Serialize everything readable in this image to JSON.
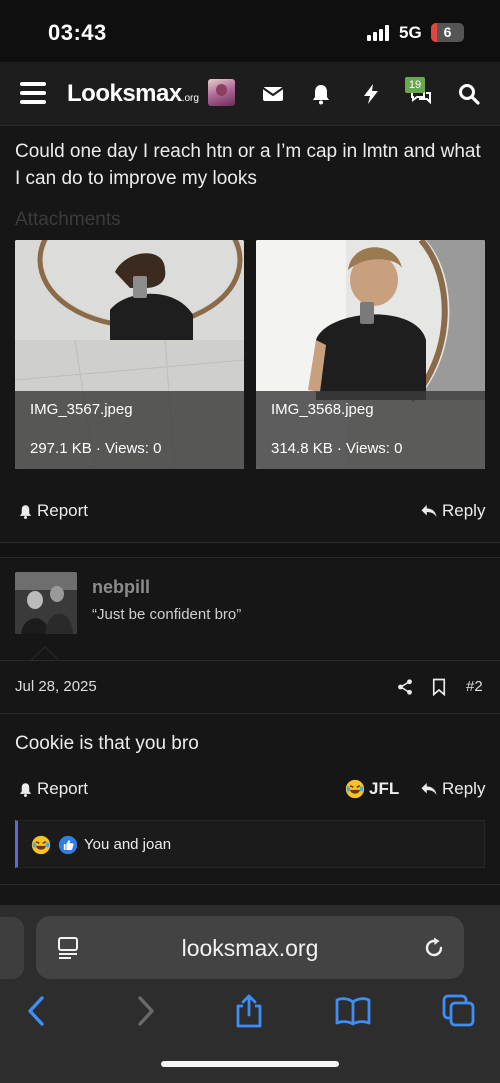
{
  "status_bar": {
    "time": "03:43",
    "network": "5G",
    "battery": "6",
    "battery_level": 0.06
  },
  "app_bar": {
    "logo_main": "Looksmax",
    "logo_suffix": ".org",
    "notification_badge": "19"
  },
  "post1": {
    "text": "Could one day I reach htn or a I’m cap in lmtn and what I can do to improve my looks",
    "attachments_label": "Attachments",
    "attachments": [
      {
        "filename": "IMG_3567.jpeg",
        "meta": "297.1 KB · Views: 0"
      },
      {
        "filename": "IMG_3568.jpeg",
        "meta": "314.8 KB · Views: 0"
      }
    ],
    "report_label": "Report",
    "reply_label": "Reply"
  },
  "post2": {
    "username": "nebpill",
    "user_title": "“Just be confident bro”",
    "date": "Jul 28, 2025",
    "number": "#2",
    "text": "Cookie is that you bro",
    "report_label": "Report",
    "reaction_label": "JFL",
    "reply_label": "Reply",
    "reactions_summary": "You and joan"
  },
  "browser": {
    "url": "looksmax.org"
  },
  "colors": {
    "accent": "#5e6ad2",
    "badge": "#6aa84f",
    "safari_blue": "#3e8ef7"
  }
}
